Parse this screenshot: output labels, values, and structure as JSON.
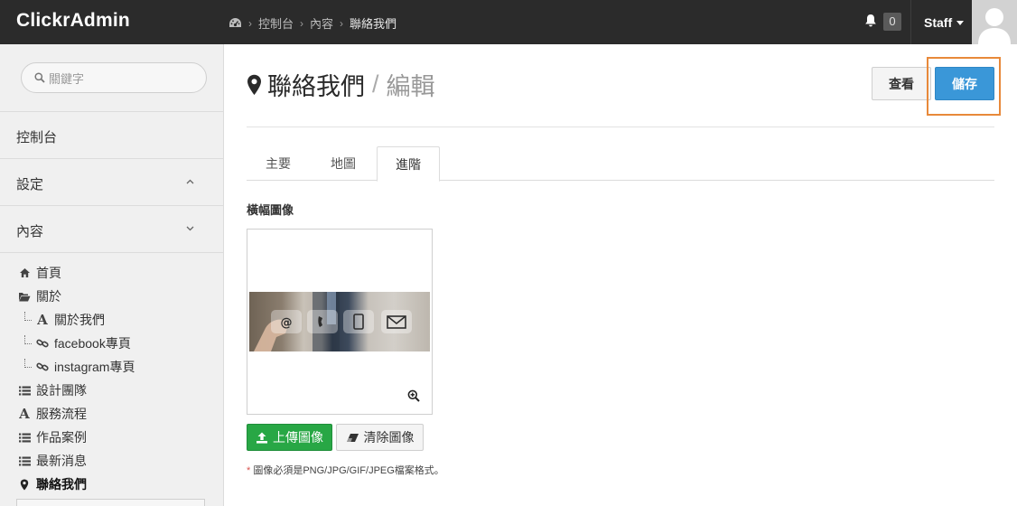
{
  "app": {
    "brand": "ClickrAdmin"
  },
  "breadcrumb": {
    "items": [
      "控制台",
      "內容",
      "聯絡我們"
    ]
  },
  "topbar": {
    "notification_count": "0",
    "user_label": "Staff"
  },
  "sidebar": {
    "search_placeholder": "關鍵字",
    "sections": [
      {
        "label": "控制台"
      },
      {
        "label": "設定"
      },
      {
        "label": "內容"
      }
    ],
    "tree": [
      {
        "label": "首頁",
        "icon": "home-icon"
      },
      {
        "label": "關於",
        "icon": "folder-open-icon"
      },
      {
        "label": "關於我們",
        "icon": "text-page-icon"
      },
      {
        "label": "facebook專頁",
        "icon": "link-icon"
      },
      {
        "label": "instagram專頁",
        "icon": "link-icon"
      },
      {
        "label": "設計團隊",
        "icon": "list-icon"
      },
      {
        "label": "服務流程",
        "icon": "text-page-icon"
      },
      {
        "label": "作品案例",
        "icon": "list-icon"
      },
      {
        "label": "最新消息",
        "icon": "list-icon"
      },
      {
        "label": "聯絡我們",
        "icon": "map-marker-icon",
        "active": true
      }
    ]
  },
  "page": {
    "title": "聯絡我們",
    "subtitle": "編輯",
    "view_button": "查看",
    "save_button": "儲存"
  },
  "tabs": [
    {
      "label": "主要",
      "active": false
    },
    {
      "label": "地圖",
      "active": false
    },
    {
      "label": "進階",
      "active": true
    }
  ],
  "banner_field": {
    "label": "橫幅圖像",
    "upload_button": "上傳圖像",
    "clear_button": "清除圖像",
    "note": "圖像必須是PNG/JPG/GIF/JPEG檔案格式。"
  }
}
